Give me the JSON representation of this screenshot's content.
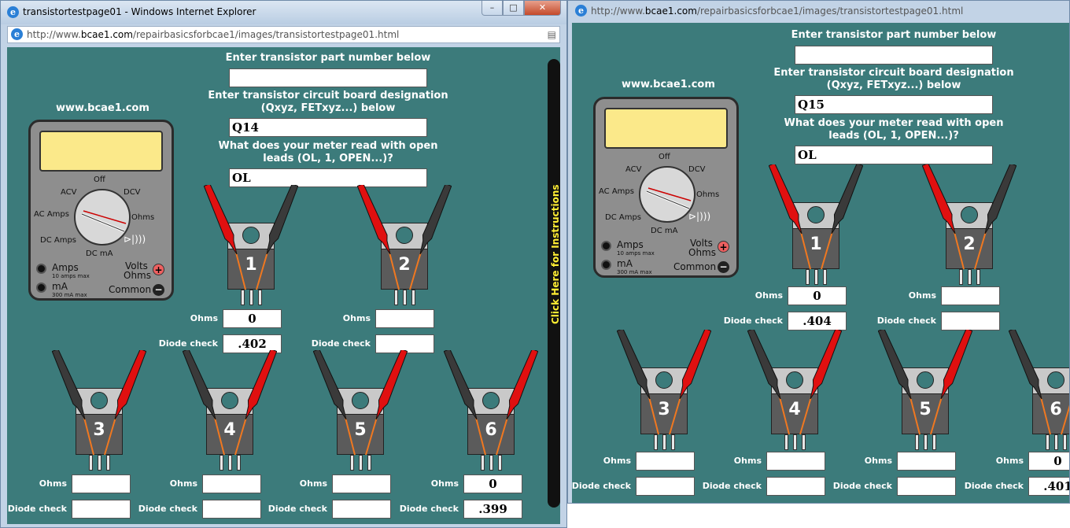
{
  "left_window": {
    "title": "transistortestpage01 - Windows Internet Explorer",
    "controls": {
      "minimize": "–",
      "maximize": "□",
      "close": "✕"
    },
    "url_prefix": "http://www.",
    "url_domain": "bcae1.com",
    "url_path": "/repairbasicsforbcae1/images/transistortestpage01.html",
    "site_label": "www.bcae1.com",
    "part_number_label": "Enter transistor part number below",
    "part_number_value": "",
    "designation_label": "Enter transistor circuit board designation (Qxyz, FETxyz...) below",
    "designation_value": "Q14",
    "open_leads_label": "What does your meter read with open leads (OL, 1, OPEN...)?",
    "open_leads_value": "OL",
    "instructions_label": "Click Here for Instructions",
    "transistors": [
      {
        "num": "1",
        "ohms": "0",
        "diode": ".402"
      },
      {
        "num": "2",
        "ohms": "",
        "diode": ""
      },
      {
        "num": "3",
        "ohms": "",
        "diode": ""
      },
      {
        "num": "4",
        "ohms": "",
        "diode": ""
      },
      {
        "num": "5",
        "ohms": "",
        "diode": ""
      },
      {
        "num": "6",
        "ohms": "0",
        "diode": ".399"
      }
    ]
  },
  "right_window": {
    "url_prefix": "http://www.",
    "url_domain": "bcae1.com",
    "url_path": "/repairbasicsforbcae1/images/transistortestpage01.html",
    "site_label": "www.bcae1.com",
    "part_number_label": "Enter transistor part number below",
    "part_number_value": "",
    "designation_label": "Enter transistor circuit board designation (Qxyz, FETxyz...) below",
    "designation_value": "Q15",
    "open_leads_label": "What does your meter read with open leads (OL, 1, OPEN...)?",
    "open_leads_value": "OL",
    "transistors": [
      {
        "num": "1",
        "ohms": "0",
        "diode": ".404"
      },
      {
        "num": "2",
        "ohms": "",
        "diode": ""
      },
      {
        "num": "3",
        "ohms": "",
        "diode": ""
      },
      {
        "num": "4",
        "ohms": "",
        "diode": ""
      },
      {
        "num": "5",
        "ohms": "",
        "diode": ""
      },
      {
        "num": "6",
        "ohms": "0",
        "diode": ".401"
      }
    ]
  },
  "labels": {
    "ohms": "Ohms",
    "diode_check": "Diode check"
  },
  "meter": {
    "off": "Off",
    "acv": "ACV",
    "dcv": "DCV",
    "ac_amps": "AC Amps",
    "ohms": "Ohms",
    "dc_amps": "DC Amps",
    "dc_ma": "DC mA",
    "amps": "Amps",
    "amps_sub": "10 amps max",
    "ma": "mA",
    "ma_sub": "300 mA max",
    "volts": "Volts",
    "ohms_jack": "Ohms",
    "common": "Common",
    "plus": "+",
    "minus": "−",
    "diode_symbol": "⊳|)))"
  },
  "colors": {
    "page_bg": "#3c7b7b",
    "lcd": "#fbe98a",
    "probe_red": "#e01010",
    "probe_black": "#3a3a3a",
    "lead_orange": "#f07820"
  }
}
